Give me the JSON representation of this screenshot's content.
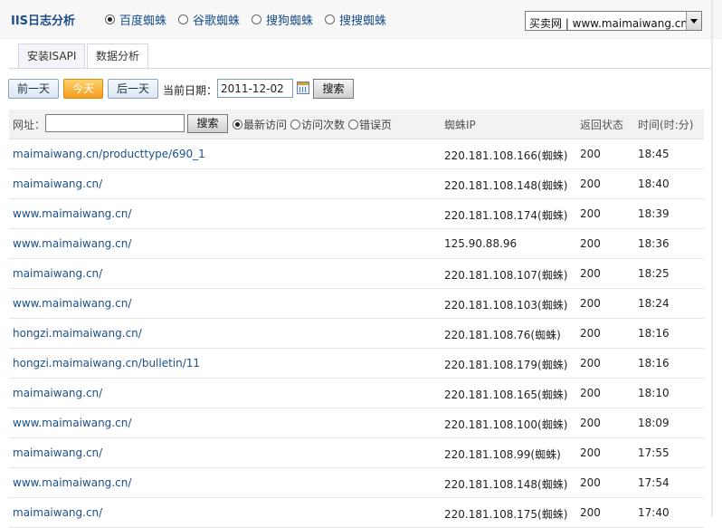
{
  "app": {
    "title": "IIS日志分析"
  },
  "engines": [
    {
      "label": "百度蜘蛛",
      "selected": true
    },
    {
      "label": "谷歌蜘蛛",
      "selected": false
    },
    {
      "label": "搜狗蜘蛛",
      "selected": false
    },
    {
      "label": "搜搜蜘蛛",
      "selected": false
    }
  ],
  "site_select": {
    "value": "买卖网 | www.maimaiwang.cn"
  },
  "tabs": [
    {
      "label": "安装ISAPI",
      "active": false
    },
    {
      "label": "数据分析",
      "active": true
    }
  ],
  "datebar": {
    "prev_label": "前一天",
    "today_label": "今天",
    "next_label": "后一天",
    "date_label": "当前日期：",
    "date_value": "2011-12-02",
    "search_label": "搜索"
  },
  "filter": {
    "url_label": "网址：",
    "url_value": "",
    "search_label": "搜索",
    "options": [
      {
        "label": "最新访问",
        "selected": true
      },
      {
        "label": "访问次数",
        "selected": false
      },
      {
        "label": "错误页",
        "selected": false
      }
    ]
  },
  "columns": {
    "ip": "蜘蛛IP",
    "status": "返回状态",
    "time": "时间(时:分)"
  },
  "rows": [
    {
      "url": "maimaiwang.cn/producttype/690_1",
      "ip": "220.181.108.166(蜘蛛)",
      "status": "200",
      "time": "18:45"
    },
    {
      "url": "maimaiwang.cn/",
      "ip": "220.181.108.148(蜘蛛)",
      "status": "200",
      "time": "18:40"
    },
    {
      "url": "www.maimaiwang.cn/",
      "ip": "220.181.108.174(蜘蛛)",
      "status": "200",
      "time": "18:39"
    },
    {
      "url": "www.maimaiwang.cn/",
      "ip": "125.90.88.96",
      "status": "200",
      "time": "18:36"
    },
    {
      "url": "maimaiwang.cn/",
      "ip": "220.181.108.107(蜘蛛)",
      "status": "200",
      "time": "18:25"
    },
    {
      "url": "www.maimaiwang.cn/",
      "ip": "220.181.108.103(蜘蛛)",
      "status": "200",
      "time": "18:24"
    },
    {
      "url": "hongzi.maimaiwang.cn/",
      "ip": "220.181.108.76(蜘蛛)",
      "status": "200",
      "time": "18:16"
    },
    {
      "url": "hongzi.maimaiwang.cn/bulletin/11",
      "ip": "220.181.108.179(蜘蛛)",
      "status": "200",
      "time": "18:16"
    },
    {
      "url": "maimaiwang.cn/",
      "ip": "220.181.108.165(蜘蛛)",
      "status": "200",
      "time": "18:10"
    },
    {
      "url": "www.maimaiwang.cn/",
      "ip": "220.181.108.100(蜘蛛)",
      "status": "200",
      "time": "18:09"
    },
    {
      "url": "maimaiwang.cn/",
      "ip": "220.181.108.99(蜘蛛)",
      "status": "200",
      "time": "17:55"
    },
    {
      "url": "www.maimaiwang.cn/",
      "ip": "220.181.108.148(蜘蛛)",
      "status": "200",
      "time": "17:54"
    },
    {
      "url": "maimaiwang.cn/",
      "ip": "220.181.108.175(蜘蛛)",
      "status": "200",
      "time": "17:40"
    }
  ]
}
